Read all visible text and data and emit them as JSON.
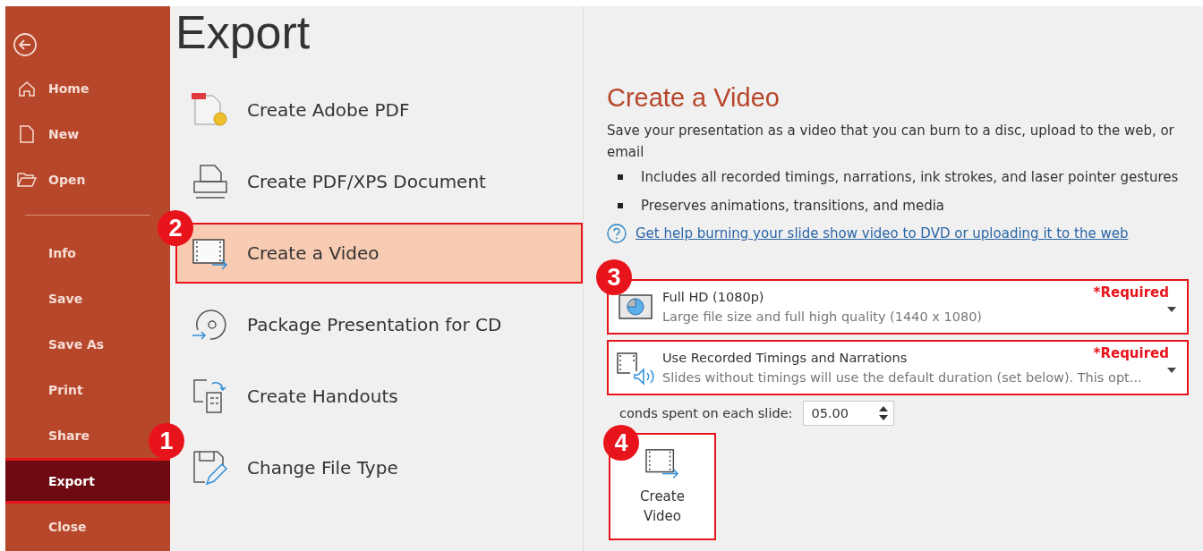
{
  "sidebar": {
    "items": [
      {
        "kind": "back"
      },
      {
        "kind": "home",
        "label": "Home",
        "selected": false
      },
      {
        "kind": "new",
        "label": "New",
        "selected": false
      },
      {
        "kind": "open",
        "label": "Open",
        "selected": false
      },
      {
        "kind": "divider"
      },
      {
        "kind": "plain",
        "label": "Info",
        "selected": false
      },
      {
        "kind": "plain",
        "label": "Save",
        "selected": false
      },
      {
        "kind": "plain",
        "label": "Save As",
        "selected": false
      },
      {
        "kind": "plain",
        "label": "Print",
        "selected": false
      },
      {
        "kind": "plain",
        "label": "Share",
        "selected": false
      },
      {
        "kind": "plain",
        "label": "Export",
        "selected": true
      },
      {
        "kind": "plain",
        "label": "Close",
        "selected": false
      }
    ]
  },
  "page_title": "Export",
  "export_options": [
    {
      "kind": "pdf",
      "label": "Create Adobe PDF",
      "selected": false
    },
    {
      "kind": "xps",
      "label": "Create PDF/XPS Document",
      "selected": false
    },
    {
      "kind": "video",
      "label": "Create a Video",
      "selected": true
    },
    {
      "kind": "cd",
      "label": "Package Presentation for CD",
      "selected": false
    },
    {
      "kind": "handouts",
      "label": "Create Handouts",
      "selected": false
    },
    {
      "kind": "filetype",
      "label": "Change File Type",
      "selected": false
    }
  ],
  "video_panel": {
    "title": "Create a Video",
    "description": "Save your presentation as a video that you can burn to a disc, upload to the web, or email",
    "bullets": [
      "Includes all recorded timings, narrations, ink strokes, and laser pointer gestures",
      "Preserves animations, transitions, and media"
    ],
    "help_link": "Get help burning your slide show video to DVD or uploading it to the web",
    "dropdowns": [
      {
        "kind": "quality",
        "title": "Full HD (1080p)",
        "detail": "Large file size and full high quality (1440 x 1080)",
        "note": "*Required"
      },
      {
        "kind": "timings",
        "title": "Use Recorded Timings and Narrations",
        "detail": "Slides without timings will use the default duration (set below). This opt...",
        "note": "*Required"
      }
    ],
    "seconds": {
      "label": "conds spent on each slide:",
      "value": "05.00"
    },
    "create_button": "Create Video"
  },
  "callouts": [
    {
      "number": "2"
    },
    {
      "number": "3"
    },
    {
      "number": "1"
    },
    {
      "number": "4"
    }
  ]
}
